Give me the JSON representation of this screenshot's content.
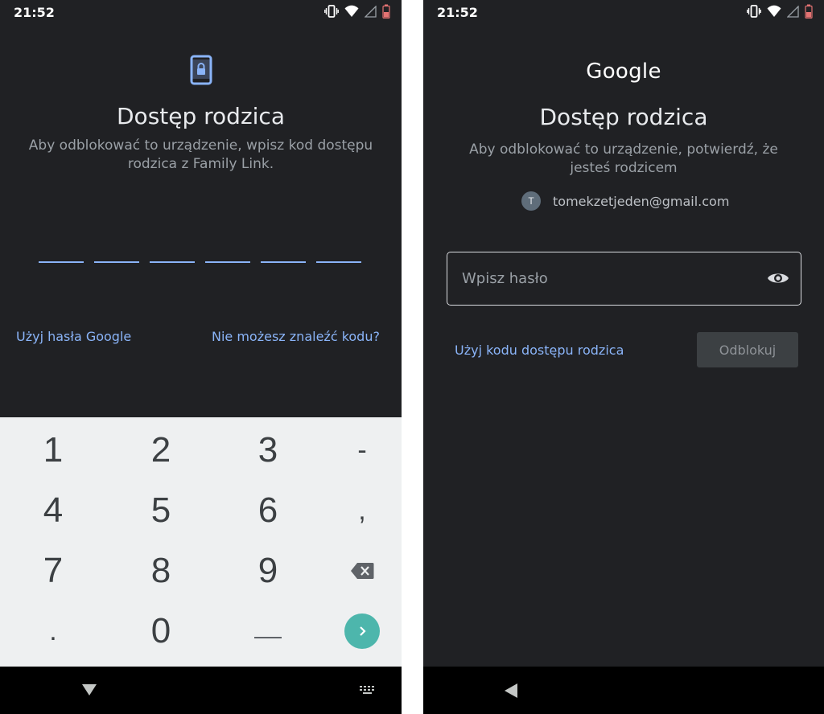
{
  "colors": {
    "background": "#202124",
    "accent": "#8ab4f8",
    "keypad": "#eef0f1",
    "go_button": "#4db6ac"
  },
  "left_screen": {
    "status_time": "21:52",
    "status_icons": [
      "vibrate-icon",
      "wifi-icon",
      "signal-icon",
      "battery-low-icon"
    ],
    "header_icon": "phone-lock-icon",
    "title": "Dostęp rodzica",
    "subtitle_line1": "Aby odblokować to urządzenie, wpisz kod dostępu",
    "subtitle_line2": "rodzica z Family Link.",
    "pin_length": 6,
    "link_google_password": "Użyj hasła Google",
    "link_cant_find_code": "Nie możesz znaleźć kodu?",
    "keypad": {
      "rows": [
        [
          "1",
          "2",
          "3",
          "-"
        ],
        [
          "4",
          "5",
          "6",
          ","
        ],
        [
          "7",
          "8",
          "9",
          "backspace-icon"
        ],
        [
          ".",
          "0",
          "space-bar-icon",
          "go-arrow-icon"
        ]
      ]
    },
    "nav": [
      "back-triangle-icon",
      "keyboard-switch-icon"
    ]
  },
  "right_screen": {
    "status_time": "21:52",
    "status_icons": [
      "vibrate-icon",
      "wifi-icon",
      "signal-icon",
      "battery-low-icon"
    ],
    "logo": "Google",
    "title": "Dostęp rodzica",
    "subtitle_line1": "Aby odblokować to urządzenie, potwierdź, że",
    "subtitle_line2": "jesteś rodzicem",
    "account": {
      "initial": "T",
      "email": "tomekzetjeden@gmail.com"
    },
    "password_placeholder": "Wpisz hasło",
    "password_value": "",
    "link_parent_code": "Użyj kodu dostępu rodzica",
    "unlock_label": "Odblokuj",
    "nav": [
      "back-triangle-icon"
    ]
  }
}
